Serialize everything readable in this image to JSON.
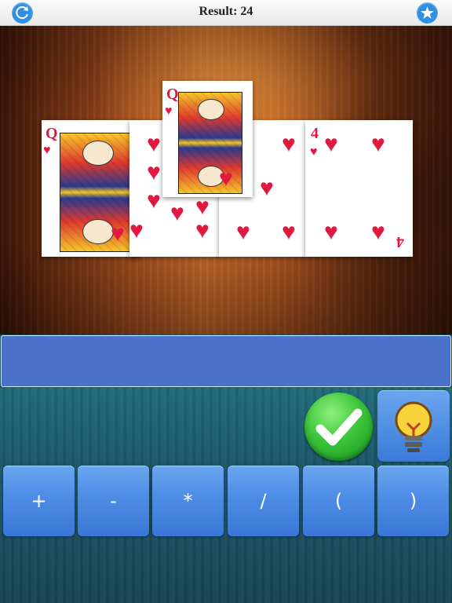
{
  "header": {
    "title": "Result: 24",
    "refresh_icon": "refresh-icon",
    "star_icon": "star-icon"
  },
  "colors": {
    "card_red": "#e2183f",
    "answer_bar": "#4a72c8",
    "button_blue": "#4d8ce6",
    "check_green": "#3cc63a"
  },
  "cards": [
    {
      "rank": "Q",
      "suit": "hearts",
      "suit_glyph": "♥"
    },
    {
      "rank": "Q",
      "suit": "hearts",
      "suit_glyph": "♥"
    },
    {
      "rank": "4",
      "suit": "hearts",
      "suit_glyph": "♥"
    },
    {
      "rank": "Q",
      "suit": "hearts",
      "suit_glyph": "♥"
    }
  ],
  "answer": {
    "expression": ""
  },
  "actions": {
    "submit_icon": "checkmark-icon",
    "hint_icon": "lightbulb-icon"
  },
  "operators": [
    "+",
    "-",
    "*",
    "/",
    "(",
    ")"
  ]
}
